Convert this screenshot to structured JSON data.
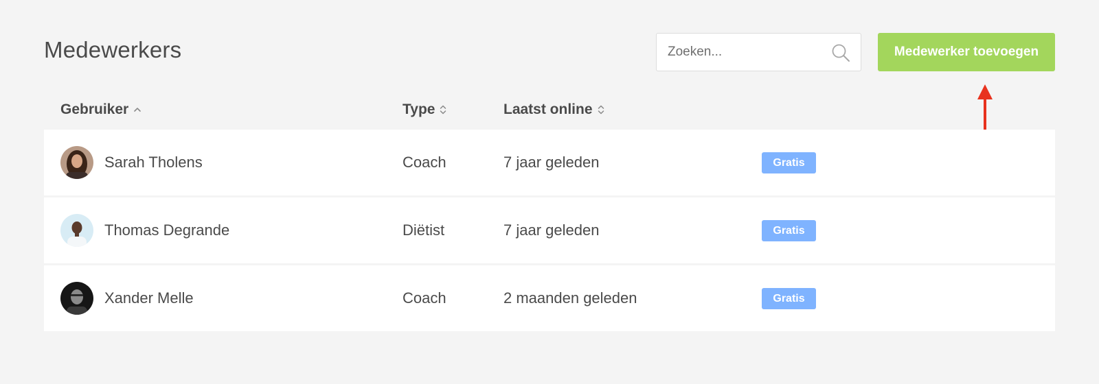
{
  "page": {
    "title": "Medewerkers"
  },
  "search": {
    "placeholder": "Zoeken...",
    "value": "",
    "icon": "search-icon"
  },
  "add_button": {
    "label": "Medewerker toevoegen",
    "color": "#a3d65c"
  },
  "annotation": {
    "icon": "arrow-up-icon",
    "color": "#e8321e"
  },
  "table": {
    "columns": [
      {
        "label": "Gebruiker",
        "sort": "ascending",
        "sort_icon": "chevron-up-icon"
      },
      {
        "label": "Type",
        "sort": "none",
        "sort_icon": "sort-icon"
      },
      {
        "label": "Laatst online",
        "sort": "none",
        "sort_icon": "sort-icon"
      }
    ],
    "rows": [
      {
        "name": "Sarah Tholens",
        "type": "Coach",
        "last_online": "7 jaar geleden",
        "badge": "Gratis"
      },
      {
        "name": "Thomas Degrande",
        "type": "Diëtist",
        "last_online": "7 jaar geleden",
        "badge": "Gratis"
      },
      {
        "name": "Xander Melle",
        "type": "Coach",
        "last_online": "2 maanden geleden",
        "badge": "Gratis"
      }
    ]
  },
  "colors": {
    "background": "#f4f4f4",
    "badge": "#7fb3ff",
    "text": "#4a4a4a"
  }
}
